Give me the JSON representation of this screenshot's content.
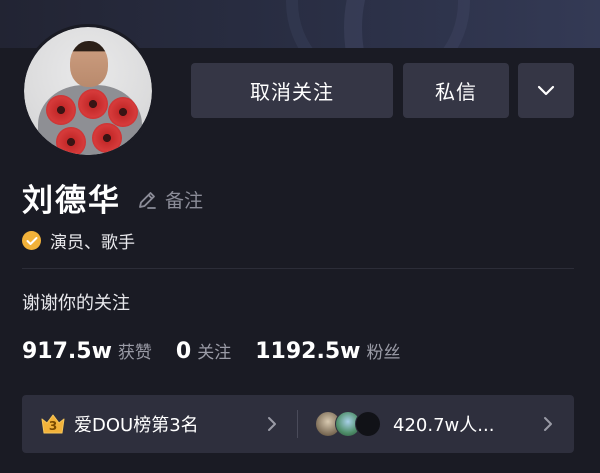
{
  "profile": {
    "name": "刘德华",
    "remark_label": "备注",
    "verification": "演员、歌手",
    "signature": "谢谢你的关注"
  },
  "actions": {
    "unfollow_label": "取消关注",
    "message_label": "私信"
  },
  "stats": [
    {
      "value": "917.5w",
      "label": "获赞"
    },
    {
      "value": "0",
      "label": "关注"
    },
    {
      "value": "1192.5w",
      "label": "粉丝"
    }
  ],
  "rank": {
    "crown_number": "3",
    "text": "爱DOU榜第3名",
    "fans_text": "420.7w人..."
  },
  "icons": {
    "edit": "pencil-icon",
    "verify": "check-badge-icon",
    "more": "chevron-down-icon",
    "crown": "crown-icon",
    "chevron": "chevron-right-icon"
  },
  "colors": {
    "background": "#1a1b24",
    "button": "#353645",
    "badge": "#f2b23a",
    "muted": "#9a9ba6"
  }
}
